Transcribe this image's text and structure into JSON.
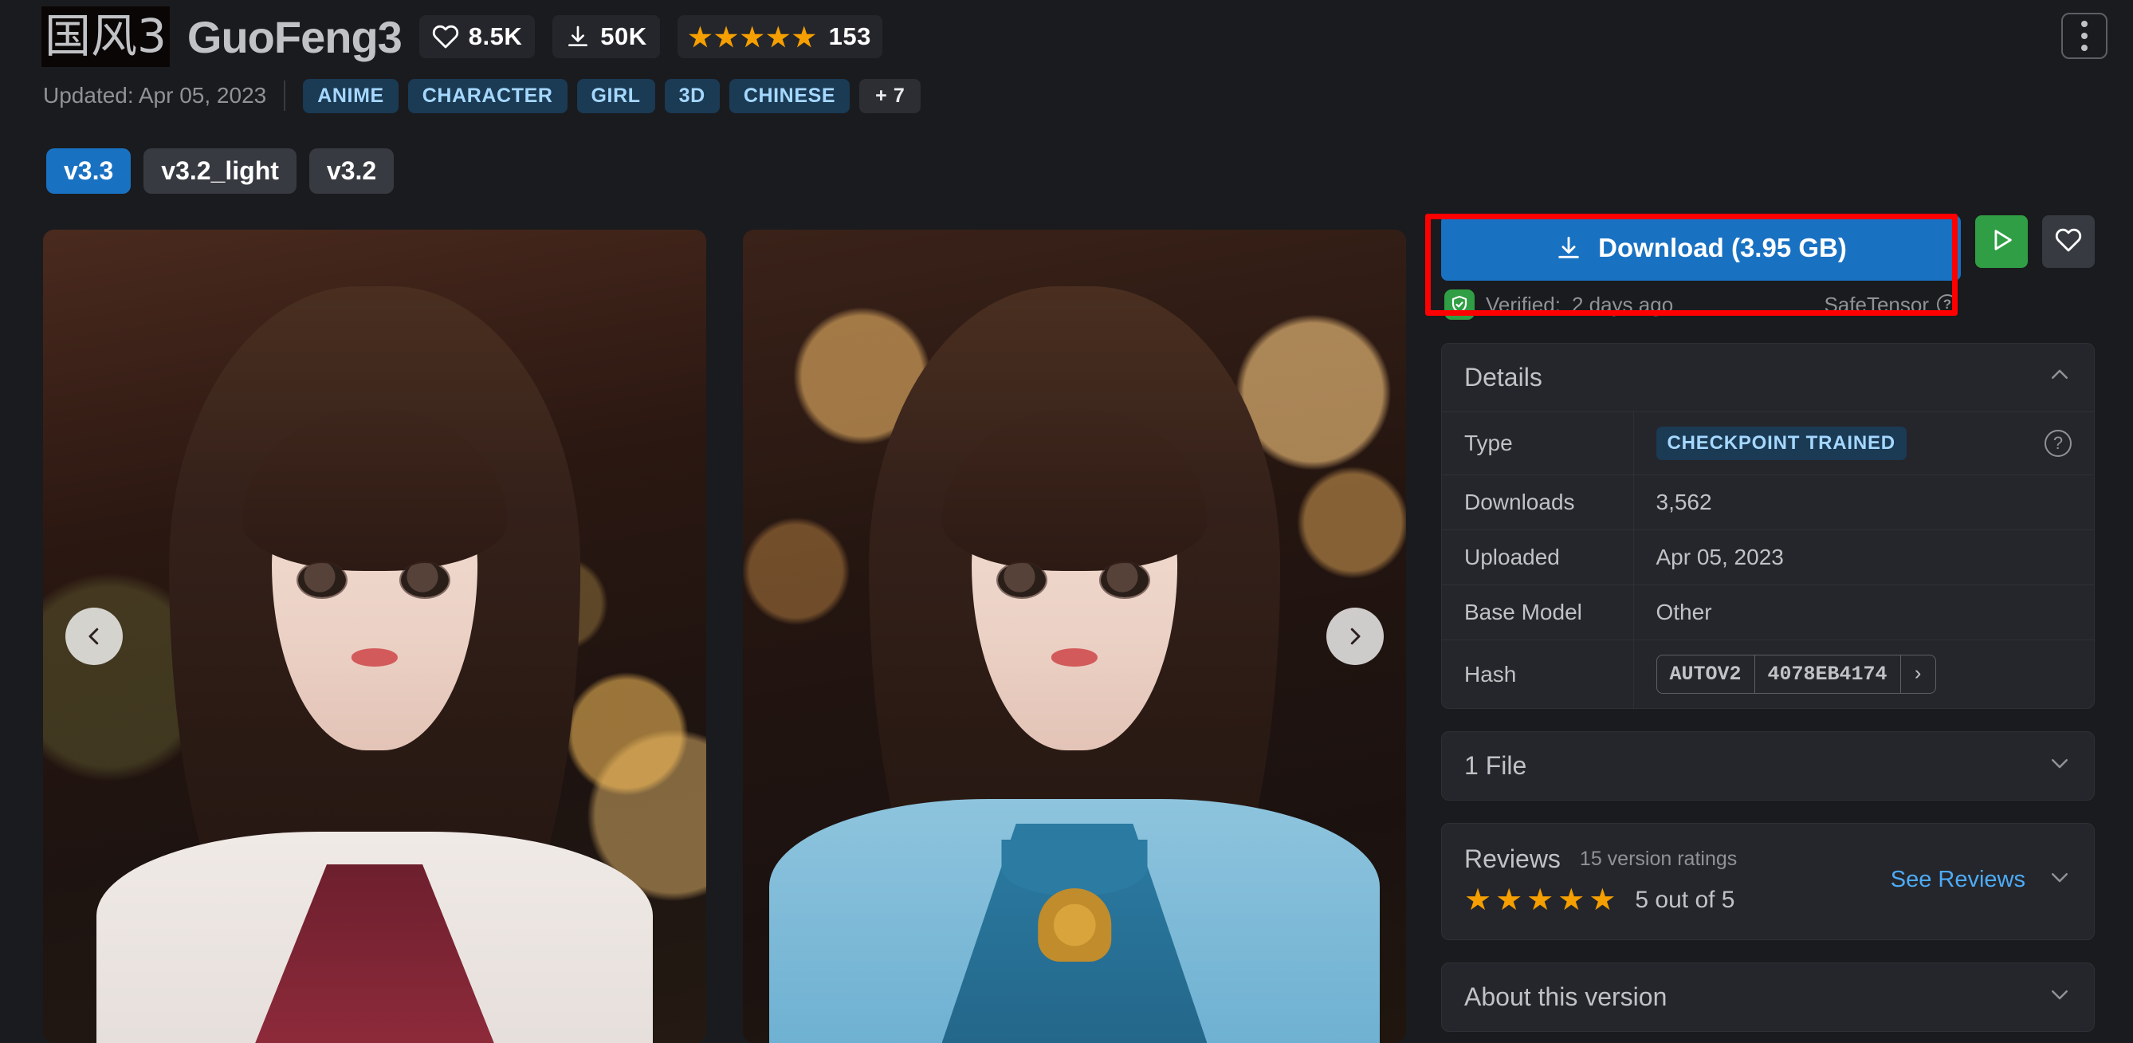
{
  "header": {
    "logo_text": "国风3",
    "title": "GuoFeng3",
    "kebab_icon": "kebab-menu-icon",
    "stats": [
      {
        "icon": "heart-icon",
        "value": "8.5K"
      },
      {
        "icon": "download-icon",
        "value": "50K"
      }
    ],
    "rating": {
      "icon": "star-icon",
      "stars": 5,
      "count": "153"
    },
    "updated_label": "Updated: Apr 05, 2023",
    "tags": [
      "ANIME",
      "CHARACTER",
      "GIRL",
      "3D",
      "CHINESE"
    ],
    "tags_more": "+ 7"
  },
  "versions": {
    "items": [
      {
        "label": "v3.3",
        "active": true
      },
      {
        "label": "v3.2_light",
        "active": false
      },
      {
        "label": "v3.2",
        "active": false
      }
    ]
  },
  "gallery": {
    "prev_icon": "chevron-left-icon",
    "next_icon": "chevron-right-icon",
    "image_count": 2
  },
  "download": {
    "icon": "download-icon",
    "label": "Download (3.95 GB)",
    "verified_prefix": "Verified:",
    "verified_when": "2 days ago",
    "verified_icon": "shield-check-icon",
    "format_label": "SafeTensor",
    "format_help_icon": "question-circle-icon",
    "run_icon": "play-icon",
    "like_icon": "heart-outline-icon",
    "accent_color": "#1971c2",
    "run_color": "#2f9e44",
    "annotation_color": "#ff0000"
  },
  "details": {
    "title": "Details",
    "collapse_icon": "chevron-up-icon",
    "rows": [
      {
        "key": "Type",
        "value": "CHECKPOINT TRAINED",
        "kind": "pill",
        "help_icon": "question-circle-icon"
      },
      {
        "key": "Downloads",
        "value": "3,562",
        "kind": "text"
      },
      {
        "key": "Uploaded",
        "value": "Apr 05, 2023",
        "kind": "text"
      },
      {
        "key": "Base Model",
        "value": "Other",
        "kind": "text"
      },
      {
        "key": "Hash",
        "kind": "hash",
        "hash_algo": "AUTOV2",
        "hash_value": "4078EB4174",
        "hash_arrow": "›"
      }
    ]
  },
  "files": {
    "title": "1 File",
    "expand_icon": "chevron-down-icon"
  },
  "reviews": {
    "title": "Reviews",
    "subtitle": "15 version ratings",
    "stars": 5,
    "score_label": "5 out of 5",
    "see_reviews_label": "See Reviews",
    "expand_icon": "chevron-down-icon",
    "star_color": "#f59f00",
    "link_color": "#4dabf7"
  },
  "about": {
    "title": "About this version",
    "expand_icon": "chevron-down-icon"
  }
}
